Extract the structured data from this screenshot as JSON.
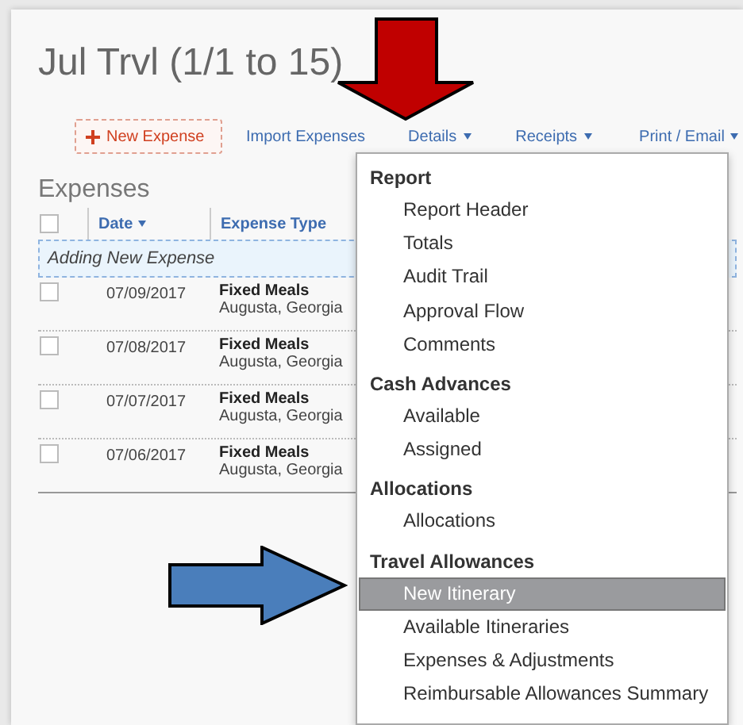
{
  "report": {
    "title": "Jul Trvl (1/1 to 15)"
  },
  "toolbar": [
    {
      "label": "New Expense",
      "kind": "primary",
      "caret": false
    },
    {
      "label": "Import Expenses",
      "kind": "link",
      "caret": false
    },
    {
      "label": "Details",
      "kind": "link",
      "caret": true
    },
    {
      "label": "Receipts",
      "kind": "link",
      "caret": true
    },
    {
      "label": "Print / Email",
      "kind": "link",
      "caret": true
    }
  ],
  "expenses": {
    "heading": "Expenses",
    "select_all_checked": false,
    "columns": [
      {
        "label": "Date",
        "sorted": true
      },
      {
        "label": "Expense Type",
        "sorted": false
      }
    ],
    "adding_row": "Adding New Expense",
    "rows": [
      {
        "checked": false,
        "date": "07/09/2017",
        "type": "Fixed Meals",
        "location": "Augusta, Georgia"
      },
      {
        "checked": false,
        "date": "07/08/2017",
        "type": "Fixed Meals",
        "location": "Augusta, Georgia"
      },
      {
        "checked": false,
        "date": "07/07/2017",
        "type": "Fixed Meals",
        "location": "Augusta, Georgia"
      },
      {
        "checked": false,
        "date": "07/06/2017",
        "type": "Fixed Meals",
        "location": "Augusta, Georgia"
      }
    ]
  },
  "details_menu": [
    {
      "heading": "Report",
      "items": [
        {
          "label": "Report Header",
          "selected": false
        },
        {
          "label": "Totals",
          "selected": false
        },
        {
          "label": "Audit Trail",
          "selected": false
        },
        {
          "label": "Approval Flow",
          "selected": false
        },
        {
          "label": "Comments",
          "selected": false
        }
      ]
    },
    {
      "heading": "Cash Advances",
      "items": [
        {
          "label": "Available",
          "selected": false
        },
        {
          "label": "Assigned",
          "selected": false
        }
      ]
    },
    {
      "heading": "Allocations",
      "items": [
        {
          "label": "Allocations",
          "selected": false
        }
      ]
    },
    {
      "heading": "Travel Allowances",
      "items": [
        {
          "label": "New Itinerary",
          "selected": true
        },
        {
          "label": "Available Itineraries",
          "selected": false
        },
        {
          "label": "Expenses & Adjustments",
          "selected": false
        },
        {
          "label": "Reimbursable Allowances Summary",
          "selected": false
        }
      ]
    }
  ],
  "annotations": [
    {
      "kind": "down",
      "color": "#c00000"
    },
    {
      "kind": "right",
      "color": "#4a7ebb"
    }
  ]
}
